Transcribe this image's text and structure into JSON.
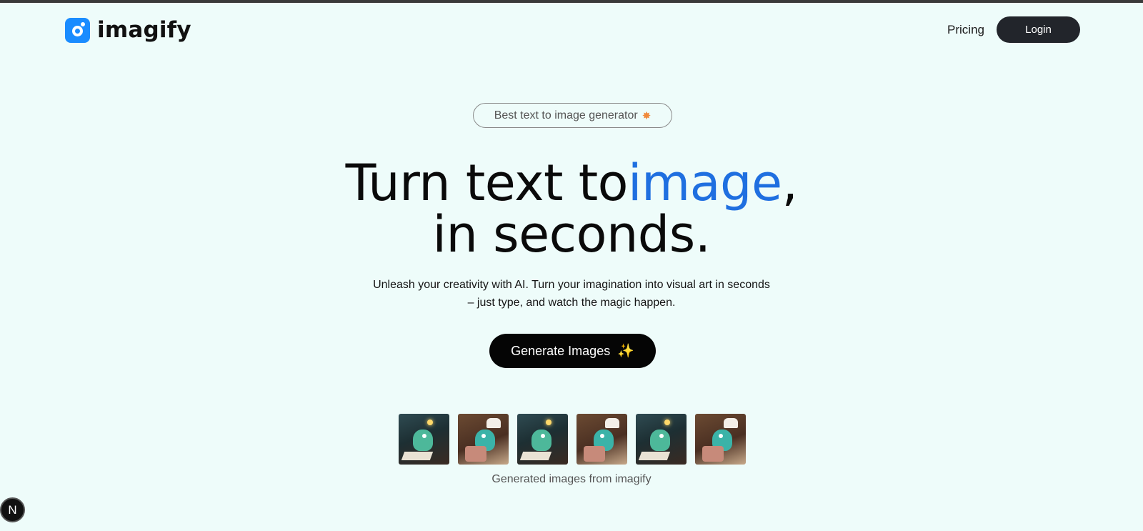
{
  "brand": {
    "name": "imagify",
    "icon": "imagify-logo-icon",
    "color": "#1a8cff"
  },
  "nav": {
    "pricing": "Pricing",
    "login": "Login"
  },
  "hero": {
    "badge": "Best text to image generator",
    "badge_icon": "starburst-icon",
    "title_part1": "Turn text to",
    "title_accent": "image",
    "title_comma": ",",
    "title_line2": "in seconds.",
    "accent_color": "#1f6fe0",
    "subtitle_line1": "Unleash your creativity with AI. Turn your imagination into visual art in seconds",
    "subtitle_line2": "– just type, and watch the magic happen.",
    "cta": "Generate Images",
    "cta_icon": "sparkles-icon"
  },
  "gallery": {
    "caption": "Generated images from imagify",
    "images": [
      "sample-image-monster-writing",
      "sample-image-monster-chef-cake",
      "sample-image-monster-writing",
      "sample-image-monster-chef-cake",
      "sample-image-monster-writing",
      "sample-image-monster-chef-cake"
    ]
  },
  "dev_badge": {
    "label": "N"
  }
}
